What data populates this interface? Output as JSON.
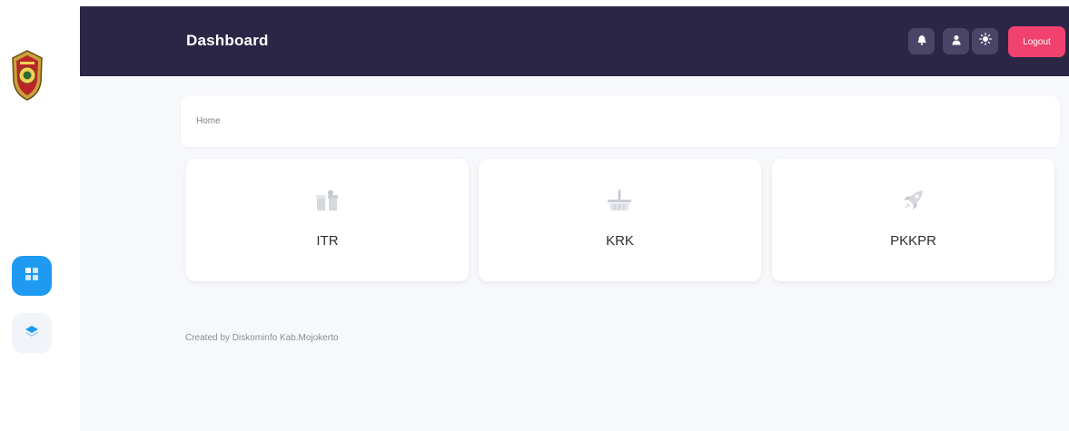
{
  "sidebar": {
    "logo_icon": "regency-crest-logo",
    "items": [
      {
        "icon": "dashboard-grid-icon",
        "active": true
      },
      {
        "icon": "layers-icon",
        "active": false
      }
    ]
  },
  "header": {
    "title": "Dashboard",
    "actions": [
      {
        "icon": "bell-icon"
      },
      {
        "icon": "user-icon"
      },
      {
        "icon": "sun-icon"
      }
    ],
    "logout_label": "Logout"
  },
  "breadcrumb": {
    "current": "Home"
  },
  "menu_cards": [
    {
      "icon": "gift-icon",
      "label": "ITR"
    },
    {
      "icon": "basket-icon",
      "label": "KRK"
    },
    {
      "icon": "rocket-icon",
      "label": "PKKPR"
    }
  ],
  "footer": {
    "prefix": "Created by",
    "credit": "Diskominfo Kab.Mojokerto"
  },
  "colors": {
    "header_bg": "#2b2646",
    "accent_blue": "#1e9bf0",
    "logout_red": "#f0416f",
    "page_bg": "#f7f8fb"
  }
}
